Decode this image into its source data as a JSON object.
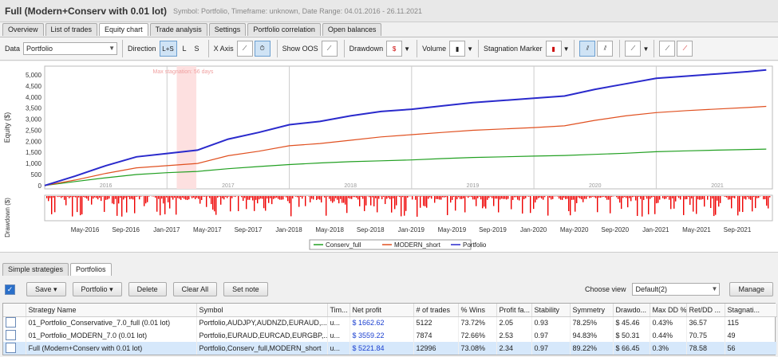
{
  "title": "Full (Modern+Conserv with 0.01 lot)",
  "meta": "Symbol: Portfolio, Timeframe: unknown, Date Range: 04.01.2016 - 26.11.2021",
  "tabs": [
    "Overview",
    "List of trades",
    "Equity chart",
    "Trade analysis",
    "Settings",
    "Portfolio correlation",
    "Open balances"
  ],
  "active_tab": 2,
  "toolbar": {
    "data_label": "Data",
    "data_value": "Portfolio",
    "direction_label": "Direction",
    "direction_options": [
      "L+S",
      "L",
      "S"
    ],
    "xaxis_label": "X Axis",
    "show_oos_label": "Show OOS",
    "drawdown_label": "Drawdown",
    "volume_label": "Volume",
    "stagnation_label": "Stagnation Marker"
  },
  "chart_data": {
    "type": "line",
    "ylabel": "Equity ($)",
    "drawdown_ylabel": "Drawdown ($)",
    "yticks": [
      0,
      500,
      1000,
      1500,
      2000,
      2500,
      3000,
      3500,
      4000,
      4500,
      5000
    ],
    "ylim": [
      -150,
      5400
    ],
    "year_labels": [
      "2016",
      "2017",
      "2018",
      "2019",
      "2020",
      "2021"
    ],
    "x_ticks": [
      "May-2016",
      "Sep-2016",
      "Jan-2017",
      "May-2017",
      "Sep-2017",
      "Jan-2018",
      "May-2018",
      "Sep-2018",
      "Jan-2019",
      "May-2019",
      "Sep-2019",
      "Jan-2020",
      "May-2020",
      "Sep-2020",
      "Jan-2021",
      "May-2021",
      "Sep-2021"
    ],
    "stagnation_label": "Max stagnation: 56 days",
    "stagnation_range": [
      2017.08,
      2017.24
    ],
    "legend": [
      "Conserv_full",
      "MODERN_short",
      "Portfolio"
    ],
    "x": [
      2016.0,
      2016.25,
      2016.5,
      2016.75,
      2017.0,
      2017.25,
      2017.5,
      2017.75,
      2018.0,
      2018.25,
      2018.5,
      2018.75,
      2019.0,
      2019.25,
      2019.5,
      2019.75,
      2020.0,
      2020.25,
      2020.5,
      2020.75,
      2021.0,
      2021.25,
      2021.5,
      2021.75,
      2021.9
    ],
    "series": [
      {
        "name": "Conserv_full",
        "color": "#22a022",
        "values": [
          0,
          180,
          350,
          500,
          580,
          640,
          760,
          860,
          950,
          1020,
          1080,
          1120,
          1160,
          1220,
          1270,
          1300,
          1330,
          1360,
          1410,
          1460,
          1530,
          1570,
          1600,
          1630,
          1650
        ]
      },
      {
        "name": "MODERN_short",
        "color": "#e05020",
        "values": [
          0,
          250,
          550,
          800,
          900,
          1000,
          1350,
          1550,
          1800,
          1900,
          2050,
          2200,
          2300,
          2400,
          2500,
          2560,
          2620,
          2700,
          2950,
          3150,
          3300,
          3390,
          3460,
          3530,
          3580
        ]
      },
      {
        "name": "Portfolio",
        "color": "#2a2acc",
        "values": [
          0,
          430,
          900,
          1300,
          1450,
          1600,
          2100,
          2400,
          2750,
          2900,
          3150,
          3350,
          3450,
          3600,
          3750,
          3850,
          3950,
          4050,
          4350,
          4600,
          4850,
          4950,
          5050,
          5150,
          5230
        ]
      }
    ]
  },
  "lower_tabs": [
    "Simple strategies",
    "Portfolios"
  ],
  "lower_active": 1,
  "buttons": {
    "save": "Save",
    "portfolio": "Portfolio",
    "delete": "Delete",
    "clear": "Clear All",
    "setnote": "Set note",
    "manage": "Manage"
  },
  "choose_view_label": "Choose view",
  "choose_view_value": "Default(2)",
  "columns": [
    "Strategy Name",
    "Symbol",
    "Tim...",
    "Net profit",
    "# of trades",
    "% Wins",
    "Profit fa...",
    "Stability",
    "Symmetry",
    "Drawdo...",
    "Max DD %",
    "Ret/DD ...",
    "Stagnati..."
  ],
  "rows": [
    [
      "01_Portfolio_Conservative_7.0_full (0.01 lot)",
      "Portfolio,AUDJPY,AUDNZD,EURAUD,...",
      "u...",
      "$ 1662.62",
      "5122",
      "73.72%",
      "2.05",
      "0.93",
      "78.25%",
      "$ 45.46",
      "0.43%",
      "36.57",
      "115"
    ],
    [
      "01_Portfolio_MODERN_7.0 (0.01 lot)",
      "Portfolio,EURAUD,EURCAD,EURGBP,...",
      "u...",
      "$ 3559.22",
      "7874",
      "72.66%",
      "2.53",
      "0.97",
      "94.83%",
      "$ 50.31",
      "0.44%",
      "70.75",
      "49"
    ],
    [
      "Full (Modern+Conserv with 0.01 lot)",
      "Portfolio,Conserv_full,MODERN_short",
      "u...",
      "$ 5221.84",
      "12996",
      "73.08%",
      "2.34",
      "0.97",
      "89.22%",
      "$ 66.45",
      "0.3%",
      "78.58",
      "56"
    ]
  ]
}
